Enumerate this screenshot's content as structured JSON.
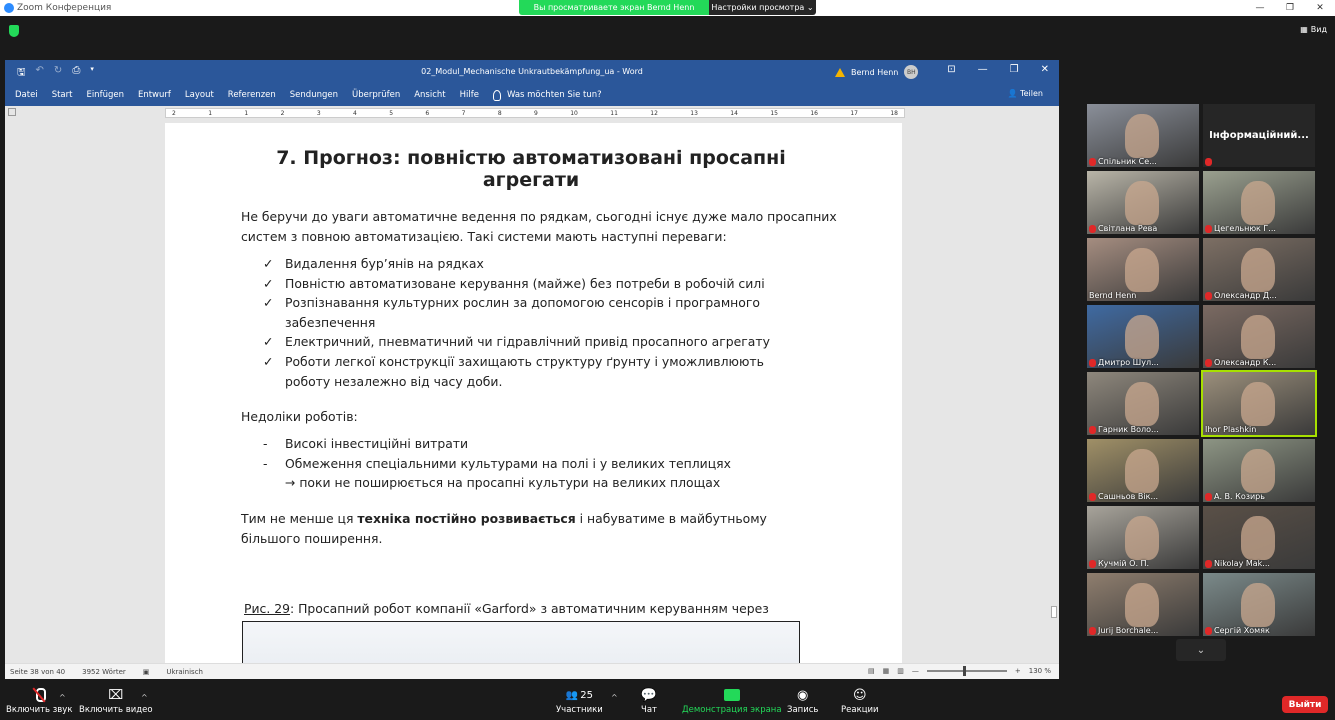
{
  "zoom": {
    "app_title": "Zoom Конференция",
    "share_banner": "Вы просматриваете экран Bernd Henn",
    "view_settings": "Настройки просмотра ⌄",
    "view_button": "Вид"
  },
  "word": {
    "doc_title": "02_Modul_Mechanische Unkrautbekämpfung_ua  -  Word",
    "user": "Bernd Henn",
    "user_initials": "BH",
    "menu": [
      "Datei",
      "Start",
      "Einfügen",
      "Entwurf",
      "Layout",
      "Referenzen",
      "Sendungen",
      "Überprüfen",
      "Ansicht",
      "Hilfe"
    ],
    "tell_me": "Was möchten Sie tun?",
    "share": "Teilen",
    "ruler_ticks": [
      "2",
      "1",
      "1",
      "2",
      "3",
      "4",
      "5",
      "6",
      "7",
      "8",
      "9",
      "10",
      "11",
      "12",
      "13",
      "14",
      "15",
      "16",
      "17",
      "18"
    ],
    "status": {
      "page": "Seite 38 von 40",
      "words": "3952 Wörter",
      "language": "Ukrainisch",
      "zoom": "130 %"
    }
  },
  "document": {
    "heading": "7. Прогноз: повністю автоматизовані просапні агрегати",
    "intro": "Не беручи до уваги автоматичне ведення по рядкам, сьогодні існує дуже мало просапних систем з повною автоматизацією. Такі системи мають наступні переваги:",
    "advantages": [
      "Видалення бур’янів на рядках",
      "Повністю автоматизоване керування (майже) без потреби в робочій силі",
      "Розпізнавання культурних рослин за допомогою сенсорів і програмного забезпечення",
      "Електричний, пневматичний чи гідравлічний привід просапного агрегату",
      "Роботи легкої конструкції захищають структуру ґрунту і уможливлюють роботу незалежно від часу доби."
    ],
    "disadvantages_title": "Недоліки роботів:",
    "disadvantages": [
      "Високі інвестиційні витрати",
      "Обмеження спеціальними культурами на полі і у великих теплицях"
    ],
    "disadvantage_note": "→ поки не поширюється на просапні культури на великих площах",
    "conclusion_pre": "Тим не менше ця ",
    "conclusion_bold": "техніка постійно розвивається",
    "conclusion_post": " і набуватиме в майбутньому більшого поширення.",
    "caption_ref": "Рис. 29",
    "caption_text": ": Просапний робот компанії «Garford» з автоматичним керуванням через камери і з регулюванням бур’янів на рядку"
  },
  "participants": [
    {
      "name": "Спільник Се...",
      "muted": true,
      "bg": "#8a8f99"
    },
    {
      "name": "Інформаційний...",
      "muted": true,
      "text_tile": true
    },
    {
      "name": "Світлана Рева",
      "muted": true,
      "bg": "#b9b5a8"
    },
    {
      "name": "Цегельнюк Г...",
      "muted": true,
      "bg": "#9aa08f"
    },
    {
      "name": "Bernd Henn",
      "muted": false,
      "bg": "#a58d80"
    },
    {
      "name": "Олександр Д...",
      "muted": true,
      "bg": "#7d6f64"
    },
    {
      "name": "Дмитро Шул...",
      "muted": true,
      "bg": "#3f6aa2"
    },
    {
      "name": "Олександр К...",
      "muted": true,
      "bg": "#7b6a62"
    },
    {
      "name": "Гарник Воло...",
      "muted": true,
      "bg": "#8e877c"
    },
    {
      "name": "Ihor Plashkin",
      "muted": false,
      "bg": "#9b8f7b",
      "active": true
    },
    {
      "name": "Сашньов Вік...",
      "muted": true,
      "bg": "#a09067"
    },
    {
      "name": "А. В. Козирь",
      "muted": true,
      "bg": "#8d9584"
    },
    {
      "name": "Кучмій О. П.",
      "muted": true,
      "bg": "#a8a49b"
    },
    {
      "name": "Nikolay Mak...",
      "muted": true,
      "bg": "#5a5047"
    },
    {
      "name": "Jurij Borchale...",
      "muted": true,
      "bg": "#8f7e6e"
    },
    {
      "name": "Сергій Хомяк",
      "muted": true,
      "bg": "#7b8a8a"
    }
  ],
  "toolbar": {
    "audio": "Включить звук",
    "video": "Включить видео",
    "participants": "Участники",
    "participants_count": "25",
    "chat": "Чат",
    "share": "Демонстрация экрана",
    "record": "Запись",
    "reactions": "Реакции",
    "leave": "Выйти"
  },
  "colors": {
    "word_blue": "#2b579a",
    "zoom_green": "#23d959",
    "leave_red": "#e02828"
  }
}
